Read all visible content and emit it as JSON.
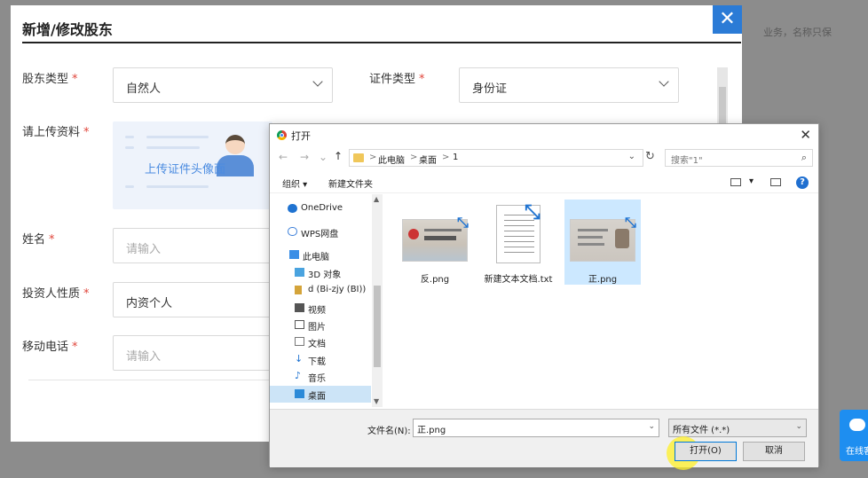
{
  "background": {
    "right_text": "业务，名称只保"
  },
  "modal": {
    "title": "新增/修改股东",
    "close_label": "✕",
    "shareholder_type": {
      "label": "股东类型",
      "value": "自然人"
    },
    "id_type": {
      "label": "证件类型",
      "value": "身份证"
    },
    "upload": {
      "label": "请上传资料",
      "text": "上传证件头像面"
    },
    "name": {
      "label": "姓名",
      "placeholder": "请输入"
    },
    "investor_nature": {
      "label": "投资人性质",
      "value": "内资个人"
    },
    "mobile": {
      "label": "移动电话",
      "placeholder": "请输入"
    },
    "required_mark": "*"
  },
  "dialog": {
    "title": "打开",
    "close_label": "✕",
    "address": {
      "back": "←",
      "forward": "→",
      "up": "↑",
      "crumbs": [
        "此电脑",
        "桌面",
        "1"
      ],
      "separator": ">",
      "dropdown": "⌄",
      "refresh": "↻"
    },
    "search": {
      "placeholder": "搜索\"1\"",
      "icon": "⌕"
    },
    "toolbar": {
      "organize": "组织 ▾",
      "new_folder": "新建文件夹",
      "view_menu": "▾",
      "help": "?"
    },
    "nav_items": [
      {
        "label": "OneDrive",
        "icon": "cloud-icon",
        "color": "#1f73d1"
      },
      {
        "label": "WPS网盘",
        "icon": "cloud-outline-icon",
        "color": "#3b7fd9"
      },
      {
        "label": "此电脑",
        "icon": "computer-icon",
        "color": "#3a8ee6"
      },
      {
        "label": "3D 对象",
        "icon": "cube-icon",
        "color": "#4aa3df"
      },
      {
        "label": "d (Bi-zjy (BI))",
        "icon": "drive-icon",
        "color": "#d4a43a"
      },
      {
        "label": "视频",
        "icon": "video-icon",
        "color": "#555555"
      },
      {
        "label": "图片",
        "icon": "picture-icon",
        "color": "#555555"
      },
      {
        "label": "文档",
        "icon": "document-icon",
        "color": "#777777"
      },
      {
        "label": "下载",
        "icon": "download-icon",
        "color": "#1f73d1"
      },
      {
        "label": "音乐",
        "icon": "music-icon",
        "color": "#1f73d1"
      },
      {
        "label": "桌面",
        "icon": "desktop-icon",
        "color": "#2b8ad8"
      }
    ],
    "selected_nav": "桌面",
    "files": [
      {
        "name": "反.png",
        "kind": "image"
      },
      {
        "name": "新建文本文档.txt",
        "kind": "text"
      },
      {
        "name": "正.png",
        "kind": "image"
      }
    ],
    "selected_file": "正.png",
    "filename_label": "文件名(N):",
    "filename_value": "正.png",
    "filetype_value": "所有文件 (*.*)",
    "open_button": "打开(O)",
    "cancel_button": "取消"
  },
  "chat_badge": {
    "label": "在线客服"
  }
}
